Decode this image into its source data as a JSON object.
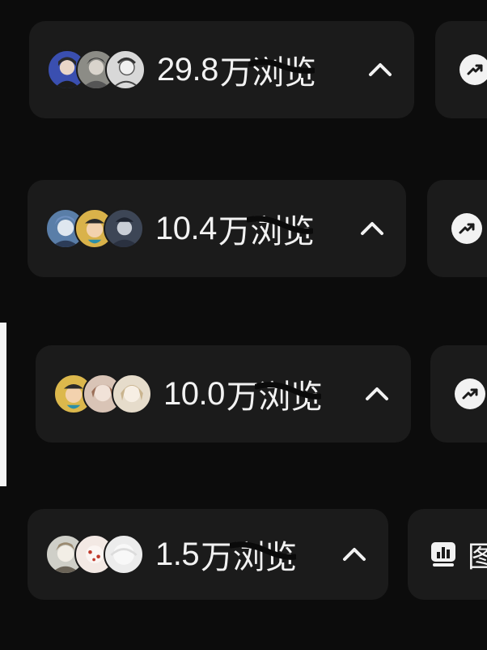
{
  "posts": [
    {
      "views_number": "29.8",
      "views_unit": "万",
      "views_word": "浏览",
      "avatars": [
        "avatar-girl-dark",
        "avatar-anime-boy",
        "avatar-sketch"
      ]
    },
    {
      "views_number": "10.4",
      "views_unit": "万",
      "views_word": "浏览",
      "avatars": [
        "avatar-blue-anime",
        "avatar-pinocchio",
        "avatar-dark-anime"
      ]
    },
    {
      "views_number": "10.0",
      "views_unit": "万",
      "views_word": "浏览",
      "avatars": [
        "avatar-pinocchio",
        "avatar-pale-girl",
        "avatar-cream-anime"
      ]
    },
    {
      "views_number": "1.5",
      "views_unit": "万",
      "views_word": "浏览",
      "avatars": [
        "avatar-pale-boy",
        "avatar-red-spots",
        "avatar-white"
      ]
    }
  ],
  "side_actions": [
    {
      "icon": "trend-up-icon"
    },
    {
      "icon": "trend-up-icon"
    },
    {
      "icon": "trend-up-icon"
    },
    {
      "icon": "bar-chart-icon",
      "label": "图"
    }
  ],
  "colors": {
    "background": "#0c0c0c",
    "card": "#1b1b1b",
    "text": "#f2f2f2",
    "scribble": "#0a0a0a"
  }
}
